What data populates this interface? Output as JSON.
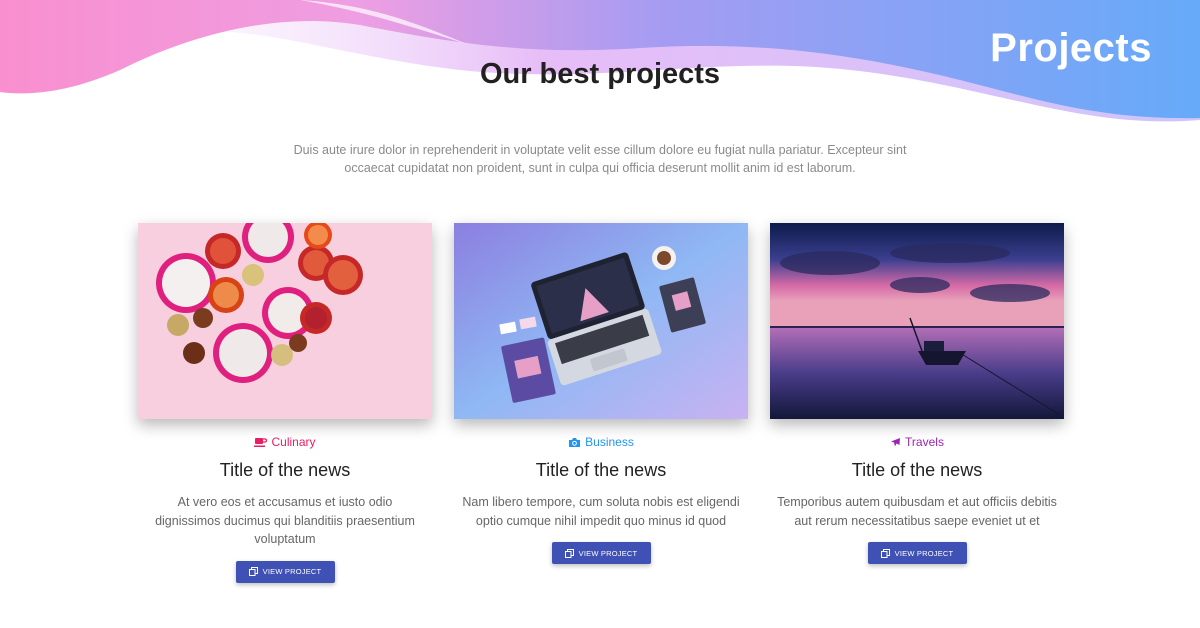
{
  "banner": {
    "title": "Projects"
  },
  "section": {
    "title": "Our best projects",
    "description": "Duis aute irure dolor in reprehenderit in voluptate velit esse cillum dolore eu fugiat nulla pariatur. Excepteur sint occaecat cupidatat non proident, sunt in culpa qui officia deserunt mollit anim id est laborum."
  },
  "cards": [
    {
      "category": "Culinary",
      "category_icon": "coffee-cup-icon",
      "category_color": "#e91e63",
      "title": "Title of the news",
      "text": "At vero eos et accusamus et iusto odio dignissimos ducimus qui blanditiis praesentium voluptatum",
      "button_label": "VIEW PROJECT"
    },
    {
      "category": "Business",
      "category_icon": "camera-icon",
      "category_color": "#2196f3",
      "title": "Title of the news",
      "text": "Nam libero tempore, cum soluta nobis est eligendi optio cumque nihil impedit quo minus id quod",
      "button_label": "VIEW PROJECT"
    },
    {
      "category": "Travels",
      "category_icon": "plane-icon",
      "category_color": "#9c27b0",
      "title": "Title of the news",
      "text": "Temporibus autem quibusdam et aut officiis debitis aut rerum necessitatibus saepe eveniet ut et",
      "button_label": "VIEW PROJECT"
    }
  ],
  "colors": {
    "button": "#3f51b5",
    "wave_pink": "#f98fcf",
    "wave_blue": "#66aaf9",
    "wave_lilac": "#e7bdf7"
  }
}
